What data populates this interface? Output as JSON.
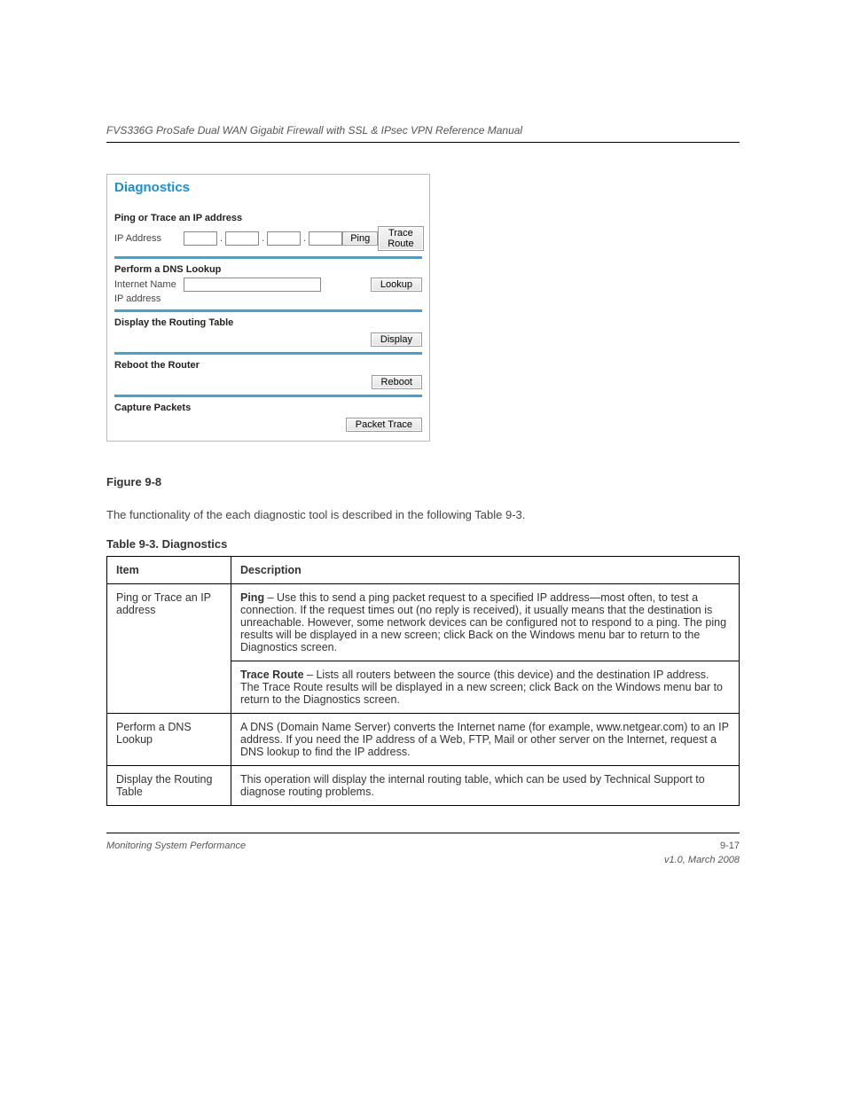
{
  "header": {
    "left": "FVS336G ProSafe Dual WAN Gigabit Firewall with SSL & IPsec VPN Reference Manual",
    "right": ""
  },
  "diagnostics": {
    "title": "Diagnostics",
    "ping_section": {
      "heading": "Ping or Trace an IP address",
      "label": "IP Address",
      "ping_btn": "Ping",
      "trace_btn": "Trace Route"
    },
    "dns_section": {
      "heading": "Perform a DNS Lookup",
      "name_label": "Internet Name",
      "ip_label": "IP address",
      "lookup_btn": "Lookup"
    },
    "routing_section": {
      "heading": "Display the Routing Table",
      "display_btn": "Display"
    },
    "reboot_section": {
      "heading": "Reboot the Router",
      "reboot_btn": "Reboot"
    },
    "capture_section": {
      "heading": "Capture Packets",
      "packet_btn": "Packet Trace"
    }
  },
  "figure_caption": "Figure 9-8",
  "body_text": "The functionality of the each diagnostic tool is described in the following Table 9-3.",
  "table": {
    "caption": "Table 9-3. Diagnostics",
    "header": {
      "c1": "Item",
      "c2": "Description"
    },
    "rows": [
      {
        "c1": "Ping or Trace an IP address",
        "c2a_strong": "Ping",
        "c2a_text": " – Use this to send a ping packet request to a specified IP address—most often, to test a connection. If the request times out (no reply is received), it usually means that the destination is unreachable. However, some network devices can be configured not to respond to a ping. The ping results will be displayed in a new screen; click Back on the Windows menu bar to return to the Diagnostics screen.",
        "c2b_strong": "Trace Route",
        "c2b_text": " – Lists all routers between the source (this device) and the destination IP address. The Trace Route results will be displayed in a new screen; click Back on the Windows menu bar to return to the Diagnostics screen."
      },
      {
        "c1": "Perform a DNS Lookup",
        "c2": "A DNS (Domain Name Server) converts the Internet name (for example, www.netgear.com) to an IP address. If you need the IP address of a Web, FTP, Mail or other server on the Internet, request a DNS lookup to find the IP address."
      },
      {
        "c1": "Display the Routing Table",
        "c2": "This operation will display the internal routing table, which can be used by Technical Support to diagnose routing problems."
      }
    ]
  },
  "footer": {
    "left": "Monitoring System Performance",
    "right_top": "9-17",
    "right_bottom": "v1.0, March 2008"
  }
}
